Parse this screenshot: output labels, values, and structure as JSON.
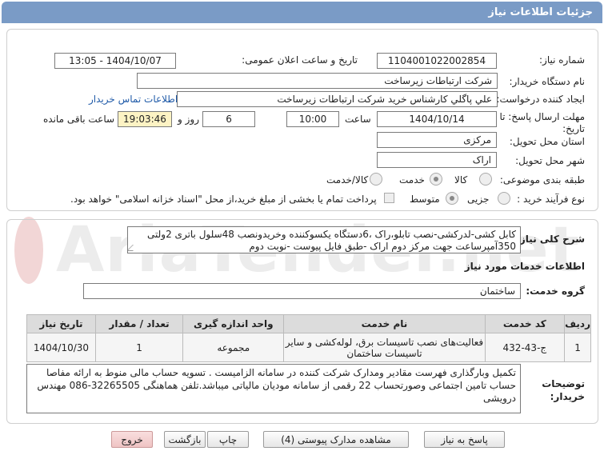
{
  "header": {
    "title": "جزئیات اطلاعات نیاز"
  },
  "form": {
    "need_number_label": "شماره نیاز:",
    "need_number": "1104001022002854",
    "announce_label": "تاریخ و ساعت اعلان عمومی:",
    "announce_value": "1404/10/07 - 13:05",
    "buyer_org_label": "نام دستگاه خریدار:",
    "buyer_org": "شرکت ارتباطات زیرساخت",
    "creator_label": "ایجاد کننده درخواست:",
    "creator": "علي پاگلي كارشناس خريد شركت ارتباطات زيرساخت",
    "contact_link": "اطلاعات تماس خریدار",
    "deadline_label_1": "مهلت ارسال پاسخ: تا",
    "deadline_label_2": "تاریخ:",
    "deadline_date": "1404/10/14",
    "time_label": "ساعت",
    "deadline_time": "10:00",
    "days_value": "6",
    "days_label": "روز و",
    "remaining_time": "19:03:46",
    "remaining_label": "ساعت باقی مانده",
    "province_label": "استان محل تحویل:",
    "province": "مرکزی",
    "city_label": "شهر محل تحویل:",
    "city": "اراک",
    "category_label": "طبقه بندی موضوعی:",
    "category_options": [
      "کالا",
      "خدمت",
      "کالا/خدمت"
    ],
    "category_selected": "خدمت",
    "process_label": "نوع فرآیند خرید :",
    "process_options": [
      "جزیی",
      "متوسط"
    ],
    "process_selected": "متوسط",
    "treasury_note": "پرداخت تمام یا بخشی از مبلغ خرید،از محل \"اسناد خزانه اسلامی\" خواهد بود."
  },
  "summary": {
    "label": "شرح کلی نیاز:",
    "text": "کابل کشی-لدرکشی-نصب تابلو،راک ،6دستگاه یکسوکننده وخریدونصب 48سلول باتری 2ولتی 350آمپرساعت جهت مرکز دوم اراک -طبق فایل پیوست -نوبت دوم"
  },
  "services": {
    "section_title": "اطلاعات خدمات مورد نیاز",
    "group_label": "گروه خدمت:",
    "group_value": "ساختمان",
    "columns": [
      "ردیف",
      "کد خدمت",
      "نام خدمت",
      "واحد اندازه گیری",
      "تعداد / مقدار",
      "تاریخ نیاز"
    ],
    "rows": [
      {
        "index": "1",
        "code": "ج-43-432",
        "name_line1": "فعالیت‌های نصب تاسیسات برق، لوله‌کشی و سایر",
        "name_line2": "تاسیسات ساختمان",
        "unit": "مجموعه",
        "qty": "1",
        "date": "1404/10/30"
      }
    ]
  },
  "notes": {
    "label_1": "توضیحات",
    "label_2": "خریدار:",
    "text": "تکمیل وبارگذاری فهرست مقادیر ومدارک شرکت کننده در سامانه الزامیست . تسویه حساب مالی منوط به ارائه مفاصا حساب تامین اجتماعی وصورتحساب 22 رقمی از سامانه مودیان مالیاتی میباشد.تلفن هماهنگی 32265505-086 مهندس درویشی"
  },
  "buttons": {
    "reply": "پاسخ به نیاز",
    "attachments": "مشاهده مدارک پیوستی (4)",
    "print": "چاپ",
    "back": "بازگشت",
    "exit": "خروج"
  },
  "watermark": {
    "brand": "AriaTender.net"
  }
}
